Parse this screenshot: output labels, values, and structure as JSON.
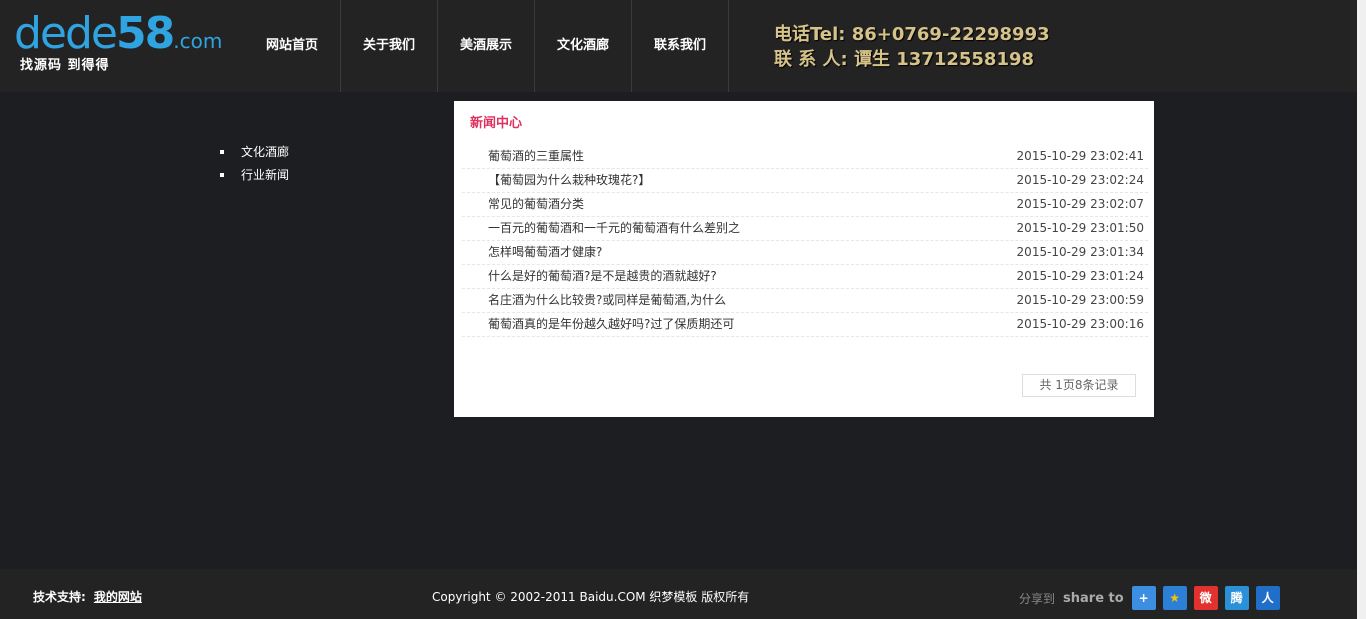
{
  "header": {
    "logo_text": "dede",
    "logo_num": "58",
    "logo_com": ".com",
    "logo_tagline": "找源码 到得得",
    "phone": "电话Tel: 86+0769-22298993",
    "contact_person": "联 系 人: 谭生 13712558198"
  },
  "nav": [
    {
      "label": "网站首页"
    },
    {
      "label": "关于我们"
    },
    {
      "label": "美酒展示"
    },
    {
      "label": "文化酒廊"
    },
    {
      "label": "联系我们"
    }
  ],
  "sidemenu": [
    {
      "label": "文化酒廊"
    },
    {
      "label": "行业新闻"
    }
  ],
  "panel": {
    "title": "新闻中心",
    "news": [
      {
        "title": "葡萄酒的三重属性",
        "date": "2015-10-29 23:02:41"
      },
      {
        "title": "【葡萄园为什么栽种玫瑰花?】",
        "date": "2015-10-29 23:02:24"
      },
      {
        "title": "常见的葡萄酒分类",
        "date": "2015-10-29 23:02:07"
      },
      {
        "title": "一百元的葡萄酒和一千元的葡萄酒有什么差别之",
        "date": "2015-10-29 23:01:50"
      },
      {
        "title": "怎样喝葡萄酒才健康?",
        "date": "2015-10-29 23:01:34"
      },
      {
        "title": "什么是好的葡萄酒?是不是越贵的酒就越好?",
        "date": "2015-10-29 23:01:24"
      },
      {
        "title": "名庄酒为什么比较贵?或同样是葡萄酒,为什么",
        "date": "2015-10-29 23:00:59"
      },
      {
        "title": "葡萄酒真的是年份越久越好吗?过了保质期还可",
        "date": "2015-10-29 23:00:16"
      }
    ],
    "pager": "共 1页8条记录"
  },
  "footer": {
    "tech_label": "技术支持:",
    "tech_link": "我的网站",
    "copyright": "Copyright © 2002-2011 Baidu.COM 织梦模板 版权所有",
    "share_label": "分享到",
    "share_en": "share to",
    "share_icons": [
      {
        "name": "plus-share-icon",
        "glyph": "+",
        "color": "#3b8ee0"
      },
      {
        "name": "star-share-icon",
        "glyph": "★",
        "color": "#2b7fd6"
      },
      {
        "name": "weibo-share-icon",
        "glyph": "微",
        "color": "#e2322f"
      },
      {
        "name": "tencent-share-icon",
        "glyph": "腾",
        "color": "#2a90d8"
      },
      {
        "name": "renren-share-icon",
        "glyph": "人",
        "color": "#1f6fc9"
      }
    ]
  }
}
